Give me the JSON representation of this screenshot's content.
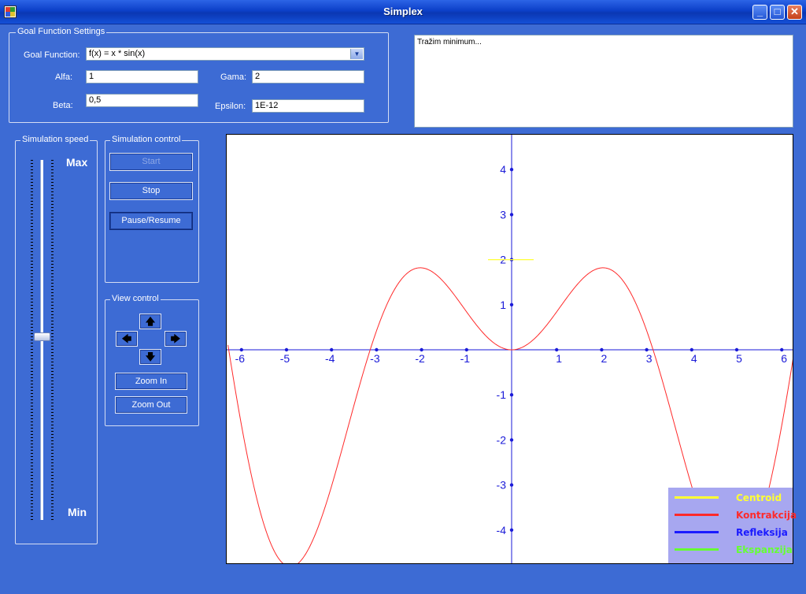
{
  "window": {
    "title": "Simplex",
    "minimize_glyph": "_",
    "maximize_glyph": "□",
    "close_glyph": "✕"
  },
  "goal_settings": {
    "group_title": "Goal Function Settings",
    "goal_function_label": "Goal Function:",
    "goal_function_value": "f(x) = x * sin(x)",
    "alfa_label": "Alfa:",
    "alfa_value": "1",
    "gama_label": "Gama:",
    "gama_value": "2",
    "beta_label": "Beta:",
    "beta_value": "0,5",
    "epsilon_label": "Epsilon:",
    "epsilon_value": "1E-12"
  },
  "output": {
    "text": "Tražim minimum..."
  },
  "speed": {
    "group_title": "Simulation speed",
    "max_label": "Max",
    "min_label": "Min",
    "level": 0.51
  },
  "sim_control": {
    "group_title": "Simulation control",
    "start_label": "Start",
    "stop_label": "Stop",
    "pause_label": "Pause/Resume"
  },
  "view_control": {
    "group_title": "View control",
    "up_icon": "🡅",
    "left_icon": "🡄",
    "right_icon": "🡆",
    "down_icon": "🡇",
    "zoom_in_label": "Zoom In",
    "zoom_out_label": "Zoom Out"
  },
  "legend": [
    {
      "name": "Centroid",
      "color": "#ffff33"
    },
    {
      "name": "Kontrakcija",
      "color": "#ff2a2a"
    },
    {
      "name": "Refleksija",
      "color": "#1a1aff"
    },
    {
      "name": "Ekspanzija",
      "color": "#66ff33"
    }
  ],
  "chart_data": {
    "type": "line",
    "function": "x * sin(x)",
    "xlim": [
      -6.3,
      6.3
    ],
    "ylim": [
      -4.8,
      4.8
    ],
    "x_ticks": [
      -6,
      -5,
      -4,
      -3,
      -2,
      -1,
      1,
      2,
      3,
      4,
      5,
      6
    ],
    "y_ticks": [
      -4,
      -3,
      -2,
      -1,
      1,
      2,
      3,
      4
    ],
    "curve_color": "#ff2a2a",
    "axis_color": "#1a1ad8",
    "centroid_marker": {
      "x": 0,
      "y": 2,
      "color": "#ffff33"
    }
  }
}
